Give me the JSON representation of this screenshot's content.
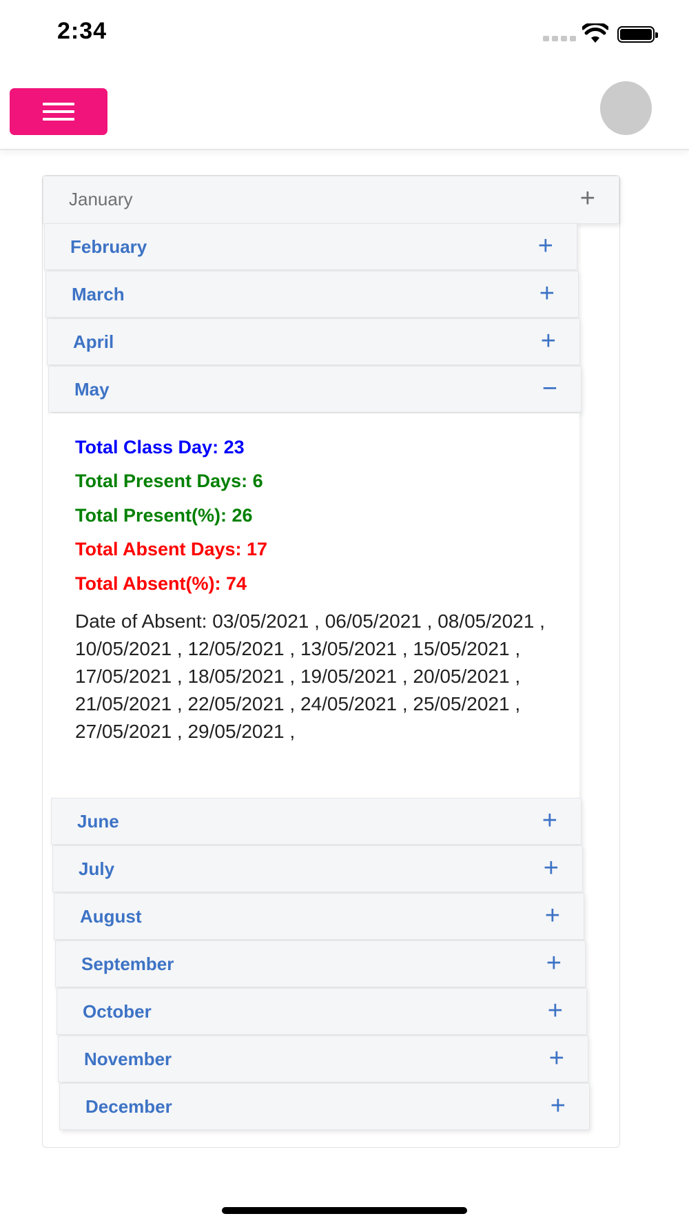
{
  "status": {
    "time": "2:34"
  },
  "months": [
    {
      "label": "January",
      "toggle": "+"
    },
    {
      "label": "February",
      "toggle": "+"
    },
    {
      "label": "March",
      "toggle": "+"
    },
    {
      "label": "April",
      "toggle": "+"
    },
    {
      "label": "May",
      "toggle": "−"
    },
    {
      "label": "June",
      "toggle": "+"
    },
    {
      "label": "July",
      "toggle": "+"
    },
    {
      "label": "August",
      "toggle": "+"
    },
    {
      "label": "September",
      "toggle": "+"
    },
    {
      "label": "October",
      "toggle": "+"
    },
    {
      "label": "November",
      "toggle": "+"
    },
    {
      "label": "December",
      "toggle": "+"
    }
  ],
  "may_details": {
    "total_class_day": "Total Class Day: 23",
    "total_present_days": "Total Present Days: 6",
    "total_present_pct": "Total Present(%): 26",
    "total_absent_days": "Total Absent Days: 17",
    "total_absent_pct": "Total Absent(%): 74",
    "date_of_absent": "Date of Absent: 03/05/2021 , 06/05/2021 , 08/05/2021 , 10/05/2021 , 12/05/2021 , 13/05/2021 , 15/05/2021 , 17/05/2021 , 18/05/2021 , 19/05/2021 , 20/05/2021 , 21/05/2021 , 22/05/2021 , 24/05/2021 , 25/05/2021 , 27/05/2021 , 29/05/2021 ,"
  },
  "colors": {
    "menu_button": "#f0147b",
    "month_label": "#3d73c5",
    "class_day": "#0000ff",
    "present": "#008000",
    "absent": "#ff0000"
  },
  "icons": {
    "menu": "hamburger-icon",
    "avatar": "user-avatar",
    "expand": "plus-icon",
    "collapse": "minus-icon"
  }
}
